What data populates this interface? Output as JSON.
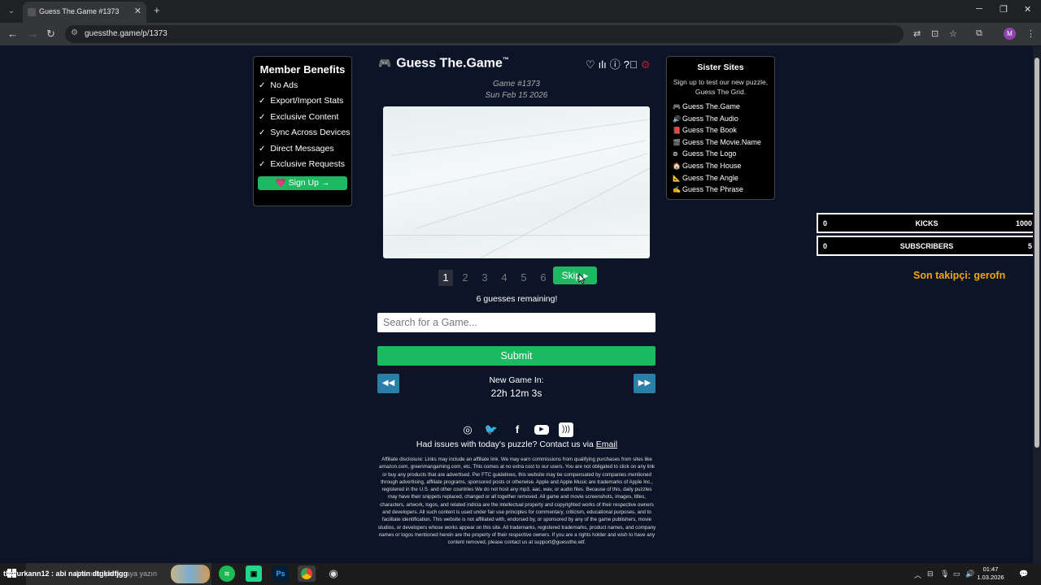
{
  "browser": {
    "tab_title": "Guess The.Game #1373",
    "url": "guessthe.game/p/1373",
    "profile_initial": "M"
  },
  "page": {
    "logo_text": "Guess The.Game",
    "logo_tm": "™",
    "game_number": "Game #1373",
    "game_date": "Sun Feb 15 2026",
    "guess_pages": [
      "1",
      "2",
      "3",
      "4",
      "5",
      "6"
    ],
    "active_page": "1",
    "skip_label": "Skip ▸",
    "remaining": "6 guesses remaining!",
    "search_placeholder": "Search for a Game...",
    "submit_label": "Submit",
    "new_game_label": "New Game In:",
    "timer": "22h 12m 3s",
    "issues_text": "Had issues with today's puzzle? Contact us via ",
    "issues_link": "Email",
    "disclaimer": "Affiliate disclosure: Links may include an affiliate link. We may earn commissions from qualifying purchases from sites like amazon.com, greenmangaming.com, etc. This comes at no extra cost to our users. You are not obligated to click on any link or buy any products that are advertised. Per FTC guidelines, this website may be compensated by companies mentioned through advertising, affiliate programs, sponsored posts or otherwise. Apple and Apple Music are trademarks of Apple Inc., registered in the U.S. and other countries We do not host any mp3, aac, wav, or audio files. Because of this, daily puzzles may have their snippets replaced, changed or all together removed. All game and movie screenshots, images, titles, characters, artwork, logos, and related indicia are the intellectual property and copyrighted works of their respective owners and developers. All such content is used under fair use principles for commentary, criticism, educational purposes, and to facilitate identification. This website is not affiliated with, endorsed by, or sponsored by any of the game publishers, movie studios, or developers whose works appear on this site. All trademarks, registered trademarks, product names, and company names or logos mentioned herein are the property of their respective owners. If you are a rights holder and wish to have any content removed, please contact us at support@guessthe.wtf."
  },
  "member_benefits": {
    "title": "Member Benefits",
    "items": [
      "No Ads",
      "Export/Import Stats",
      "Exclusive Content",
      "Sync Across Devices",
      "Direct Messages",
      "Exclusive Requests"
    ],
    "signup_label": "Sign Up →"
  },
  "sister_sites": {
    "title": "Sister Sites",
    "blurb": "Sign up to test our new puzzle, Guess The Grid.",
    "items": [
      {
        "label": "Guess The.Game",
        "icon": "🎮"
      },
      {
        "label": "Guess The Audio",
        "icon": "🔊"
      },
      {
        "label": "Guess The Book",
        "icon": "📕"
      },
      {
        "label": "Guess The Movie.Name",
        "icon": "🎬"
      },
      {
        "label": "Guess The Logo",
        "icon": "⊚"
      },
      {
        "label": "Guess The House",
        "icon": "🏠"
      },
      {
        "label": "Guess The Angle",
        "icon": "📐"
      },
      {
        "label": "Guess The Phrase",
        "icon": "✍"
      }
    ]
  },
  "overlay": {
    "kicks_left": "0",
    "kicks_label": "KICKS",
    "kicks_goal": "1000",
    "subs_left": "0",
    "subs_label": "SUBSCRIBERS",
    "subs_goal": "5",
    "last_follower": "Son takipçi: gerofn"
  },
  "taskbar": {
    "search_placeholder": "Aramak için buraya yazın",
    "overlay_text": "thefurkann12 : abi naptin dtgkidfjgg",
    "time": "01:47",
    "date": "1.03.2026"
  },
  "colors": {
    "background": "#0c1528",
    "green": "#1db862",
    "blue": "#2a7fa8",
    "gold": "#f0a513",
    "gear_red": "#c0182a"
  }
}
